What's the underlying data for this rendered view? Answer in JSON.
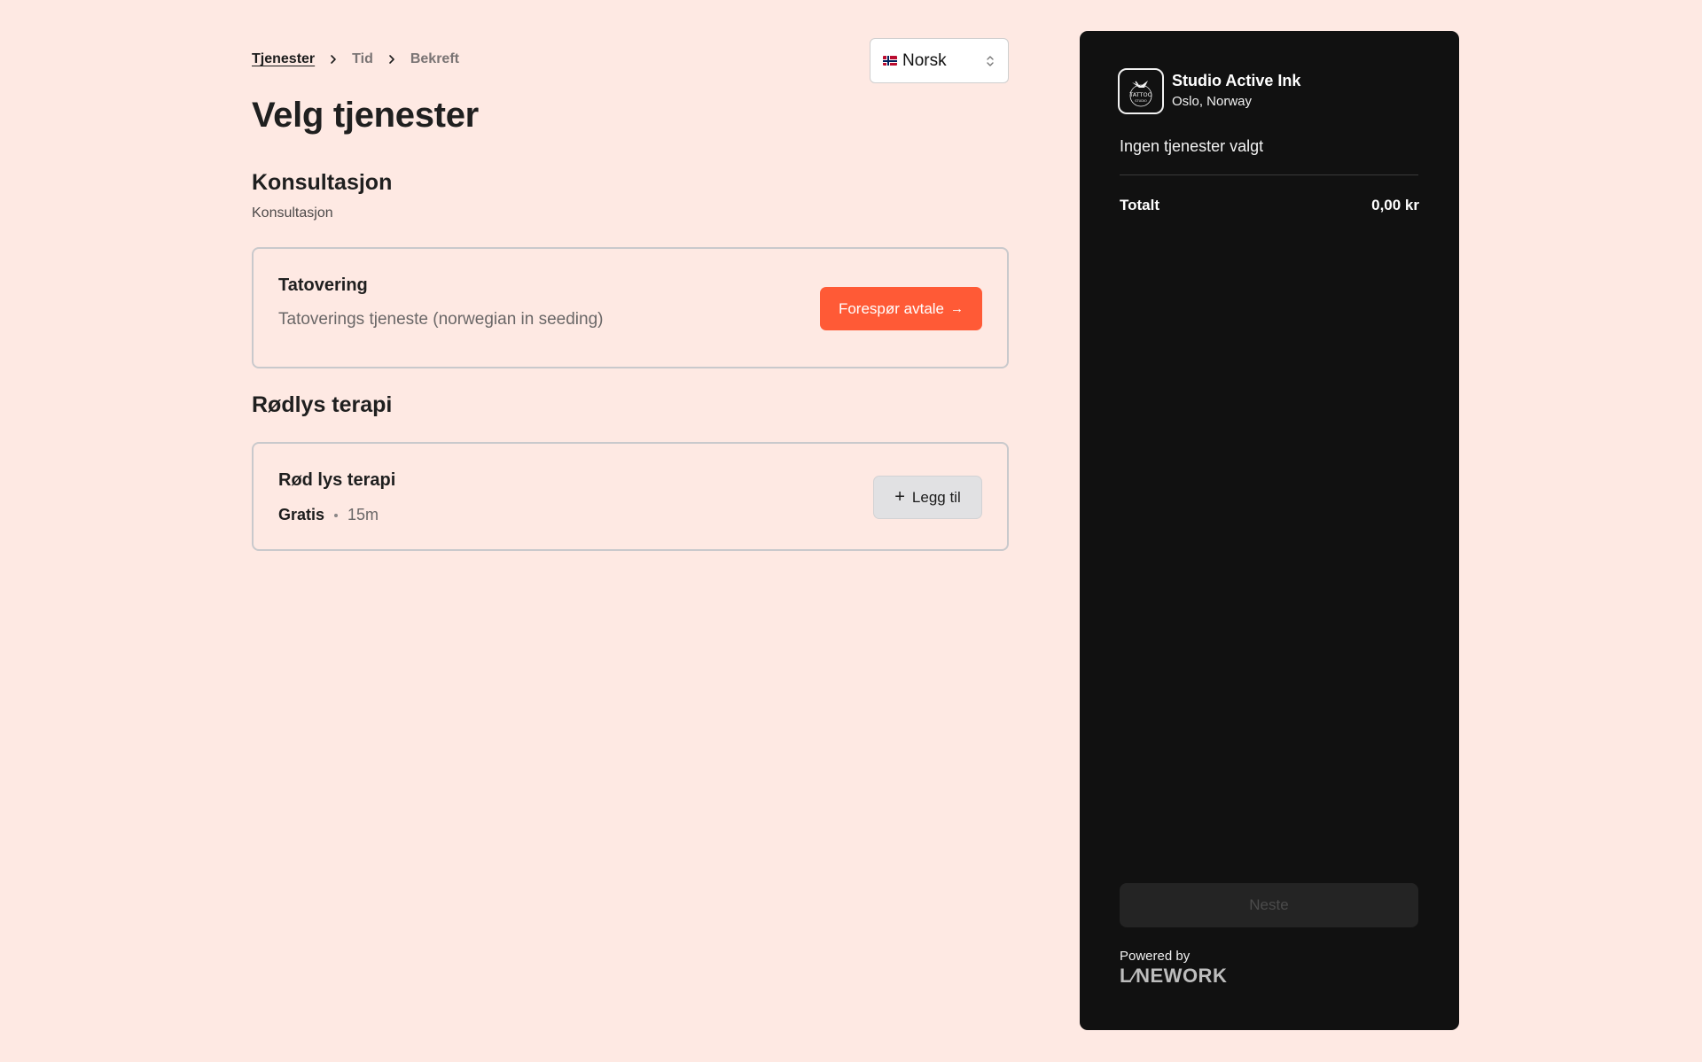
{
  "breadcrumb": {
    "items": [
      {
        "label": "Tjenester",
        "active": true
      },
      {
        "label": "Tid",
        "active": false
      },
      {
        "label": "Bekreft",
        "active": false
      }
    ]
  },
  "language": {
    "selected": "Norsk",
    "flag": "norway-flag-icon"
  },
  "page": {
    "title": "Velg tjenester"
  },
  "sections": [
    {
      "title": "Konsultasjon",
      "subtitle": "Konsultasjon",
      "services": [
        {
          "name": "Tatovering",
          "description": "Tatoverings tjeneste (norwegian in seeding)",
          "action_label": "Forespør avtale",
          "action_icon": "arrow-right-icon"
        }
      ]
    },
    {
      "title": "Rødlys terapi",
      "services": [
        {
          "name": "Rød lys terapi",
          "price": "Gratis",
          "duration": "15m",
          "action_label": "Legg til",
          "action_icon": "plus-icon"
        }
      ]
    }
  ],
  "summary": {
    "studio_name": "Studio Active Ink",
    "studio_location": "Oslo, Norway",
    "logo_text": "TATTOO",
    "logo_subtext": "STUDIO",
    "empty_text": "Ingen tjenester valgt",
    "total_label": "Totalt",
    "total_value": "0,00 kr",
    "next_label": "Neste",
    "powered_by": "Powered by",
    "brand": "L⁄NEWORK"
  },
  "colors": {
    "background": "#fee9e3",
    "accent": "#ff5a36",
    "sidebar": "#111111"
  }
}
